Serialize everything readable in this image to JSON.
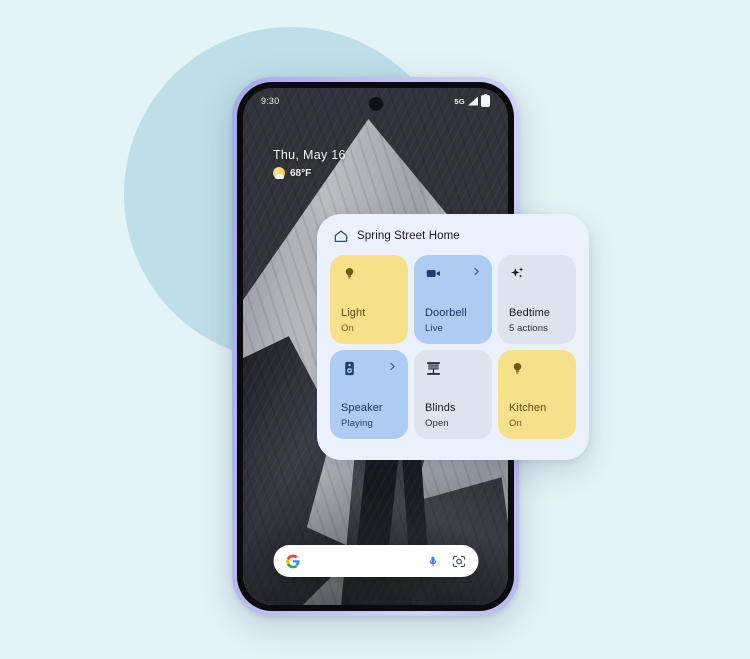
{
  "background": {
    "page_color": "#e4f3f5",
    "circle_color": "#bedfe7"
  },
  "phone": {
    "frame_color": "#b9bcf0",
    "statusbar": {
      "time": "9:30",
      "network": "5G",
      "signal_icon": "signal-bars-icon",
      "battery_icon": "battery-icon",
      "camera_icon": "front-camera-hole"
    },
    "date_widget": {
      "date": "Thu, May 16",
      "temperature": "68°F",
      "weather_icon": "partly-sunny-icon"
    },
    "search_bar": {
      "logo": "google-g-icon",
      "mic": "microphone-icon",
      "lens": "google-lens-icon",
      "placeholder": ""
    }
  },
  "widget": {
    "home_icon": "home-outline-icon",
    "title": "Spring Street Home",
    "tiles": [
      {
        "name": "Light",
        "status": "On",
        "color": "yellow",
        "icon": "lightbulb-icon",
        "chevron": false
      },
      {
        "name": "Doorbell",
        "status": "Live",
        "color": "blue",
        "icon": "video-camera-icon",
        "chevron": true
      },
      {
        "name": "Bedtime",
        "status": "5 actions",
        "color": "grey",
        "icon": "sparkles-icon",
        "chevron": false
      },
      {
        "name": "Speaker",
        "status": "Playing",
        "color": "blue",
        "icon": "speaker-icon",
        "chevron": true
      },
      {
        "name": "Blinds",
        "status": "Open",
        "color": "grey",
        "icon": "blinds-icon",
        "chevron": false
      },
      {
        "name": "Kitchen",
        "status": "On",
        "color": "yellow",
        "icon": "lightbulb-icon",
        "chevron": false
      }
    ]
  }
}
